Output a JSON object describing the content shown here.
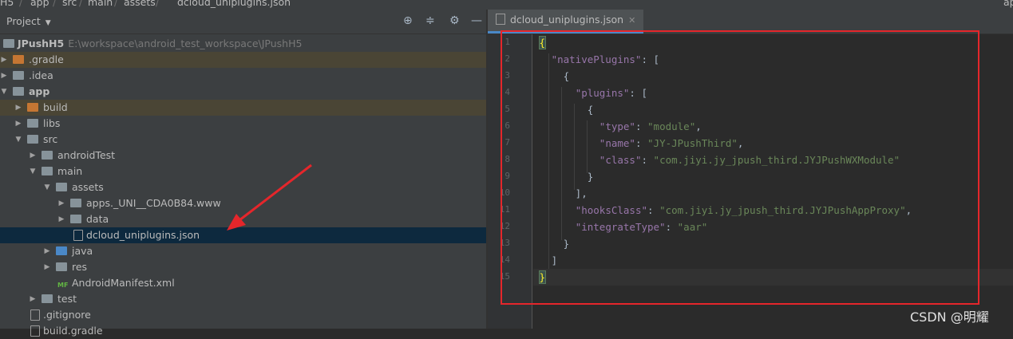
{
  "breadcrumb": [
    "H5",
    "app",
    "src",
    "main",
    "assets",
    "dcloud_uniplugins.json"
  ],
  "top_right_label": "ap",
  "project_panel": {
    "title": "Project",
    "root": {
      "name": "JPushH5",
      "path": "E:\\workspace\\android_test_workspace\\JPushH5"
    },
    "items": [
      {
        "label": ".gradle"
      },
      {
        "label": ".idea"
      },
      {
        "label": "app"
      },
      {
        "label": "build"
      },
      {
        "label": "libs"
      },
      {
        "label": "src"
      },
      {
        "label": "androidTest"
      },
      {
        "label": "main"
      },
      {
        "label": "assets"
      },
      {
        "label": "apps._UNI__CDA0B84.www"
      },
      {
        "label": "data"
      },
      {
        "label": "dcloud_uniplugins.json"
      },
      {
        "label": "java"
      },
      {
        "label": "res"
      },
      {
        "label": "AndroidManifest.xml"
      },
      {
        "label": "test"
      },
      {
        "label": ".gitignore"
      },
      {
        "label": "build.gradle"
      }
    ]
  },
  "editor": {
    "tab_label": "dcloud_uniplugins.json",
    "line_numbers": [
      "1",
      "2",
      "3",
      "4",
      "5",
      "6",
      "7",
      "8",
      "9",
      "10",
      "11",
      "12",
      "13",
      "14",
      "15"
    ],
    "lines": [
      "{",
      "  \"nativePlugins\": [",
      "    {",
      "      \"plugins\": [",
      "        {",
      "          \"type\": \"module\",",
      "          \"name\": \"JY-JPushThird\",",
      "          \"class\": \"com.jiyi.jy_jpush_third.JYJPushWXModule\"",
      "        }",
      "      ],",
      "      \"hooksClass\": \"com.jiyi.jy_jpush_third.JYJPushAppProxy\",",
      "      \"integrateType\": \"aar\"",
      "    }",
      "  ]",
      "}"
    ]
  },
  "watermark": "CSDN @明耀",
  "colors": {
    "highlight_box": "#e5262b",
    "arrow": "#e5262b"
  }
}
